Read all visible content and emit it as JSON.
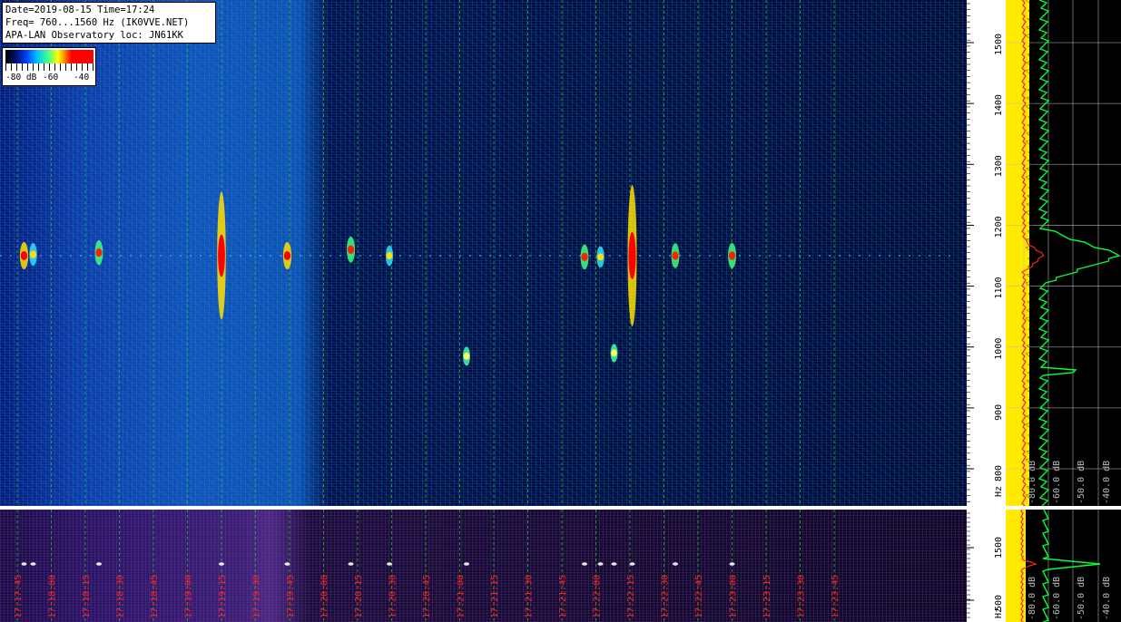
{
  "info": {
    "line1": "Date=2019-08-15 Time=17:24",
    "line2": "Freq= 760...1560 Hz (IK0VVE.NET)",
    "line3": "APA-LAN Observatory loc: JN61KK"
  },
  "colorbar": {
    "labels": [
      "-80 dB",
      "-60",
      "-40"
    ],
    "colors": [
      "#000000",
      "#001070",
      "#0040ff",
      "#00c0ff",
      "#40ff90",
      "#ffff00",
      "#ff0000"
    ]
  },
  "chart_data": [
    {
      "type": "heatmap",
      "title": "",
      "xlabel": "",
      "ylabel": "Hz",
      "freq_range": [
        760,
        1560
      ],
      "freq_ticks": [
        800,
        900,
        1000,
        1100,
        1200,
        1300,
        1400,
        1500
      ],
      "time_ticks": [
        "17:17:45",
        "17:18:00",
        "17:18:15",
        "17:18:30",
        "17:18:45",
        "17:19:00",
        "17:19:15",
        "17:19:30",
        "17:19:45",
        "17:20:00",
        "17:20:15",
        "17:20:30",
        "17:20:45",
        "17:21:00",
        "17:21:15",
        "17:21:30",
        "17:21:45",
        "17:22:00",
        "17:22:15",
        "17:22:30",
        "17:22:45",
        "17:23:00",
        "17:23:15",
        "17:23:30",
        "17:23:45"
      ],
      "carrier_freq": 1150,
      "echoes": [
        {
          "time": "17:17:48",
          "freq": 1150,
          "strength": -40
        },
        {
          "time": "17:17:52",
          "freq": 1152,
          "strength": -48
        },
        {
          "time": "17:18:21",
          "freq": 1155,
          "strength": -44
        },
        {
          "time": "17:19:15",
          "freq": 1150,
          "strength": -35
        },
        {
          "time": "17:19:44",
          "freq": 1150,
          "strength": -40
        },
        {
          "time": "17:20:12",
          "freq": 1160,
          "strength": -42
        },
        {
          "time": "17:20:29",
          "freq": 1150,
          "strength": -52
        },
        {
          "time": "17:21:03",
          "freq": 985,
          "strength": -55
        },
        {
          "time": "17:21:55",
          "freq": 1148,
          "strength": -44
        },
        {
          "time": "17:22:02",
          "freq": 1148,
          "strength": -50
        },
        {
          "time": "17:22:08",
          "freq": 990,
          "strength": -56
        },
        {
          "time": "17:22:16",
          "freq": 1150,
          "strength": -30
        },
        {
          "time": "17:22:35",
          "freq": 1150,
          "strength": -44
        },
        {
          "time": "17:23:00",
          "freq": 1150,
          "strength": -43
        }
      ],
      "grid": true
    },
    {
      "type": "line",
      "title": "",
      "xlabel": "",
      "ylabel": "Hz",
      "x_ticks": [
        "-80.0 dB",
        "-60.0 dB",
        "-50.0 dB",
        "-40.0 dB"
      ],
      "series_colors": [
        "#00ff3c",
        "#ff2020",
        "#ffea00"
      ],
      "peak_freq": 1150,
      "xlim": [
        -90,
        -30
      ]
    }
  ],
  "bottom_panel": {
    "freq_ticks": [
      "500",
      "1500"
    ],
    "x_ticks": [
      "-80.0 dB",
      "-60.0 dB",
      "-50.0 dB",
      "-40.0 dB"
    ]
  }
}
